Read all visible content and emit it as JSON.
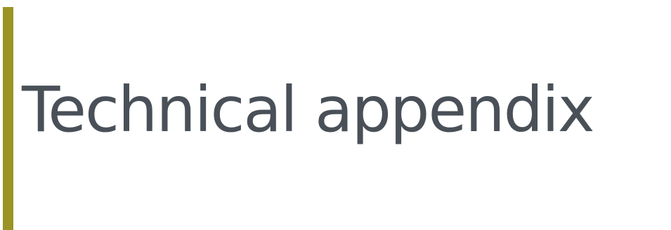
{
  "slide": {
    "title": "Technical appendix"
  },
  "colors": {
    "accent": "#9c9327",
    "title": "#4a5058",
    "background": "#ffffff"
  }
}
